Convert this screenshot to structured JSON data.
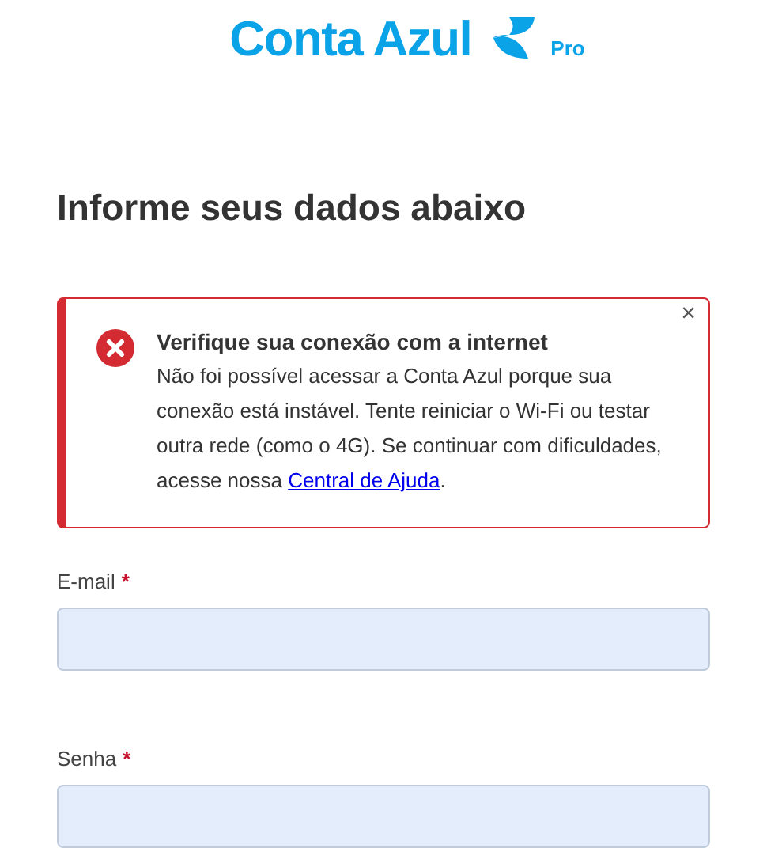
{
  "logo": {
    "brand": "Conta Azul",
    "edition": "Pro"
  },
  "heading": "Informe seus dados abaixo",
  "alert": {
    "title": "Verifique sua conexão com a internet",
    "message_before": "Não foi possível acessar a Conta Azul porque sua conexão está instável. Tente reiniciar o Wi-Fi ou testar outra rede (como o 4G). Se continuar com dificuldades, acesse nossa ",
    "link": "Central de Ajuda",
    "message_after": ".",
    "close": "×"
  },
  "fields": [
    {
      "label": "E-mail",
      "required_mark": "*"
    },
    {
      "label": "Senha",
      "required_mark": "*"
    }
  ]
}
